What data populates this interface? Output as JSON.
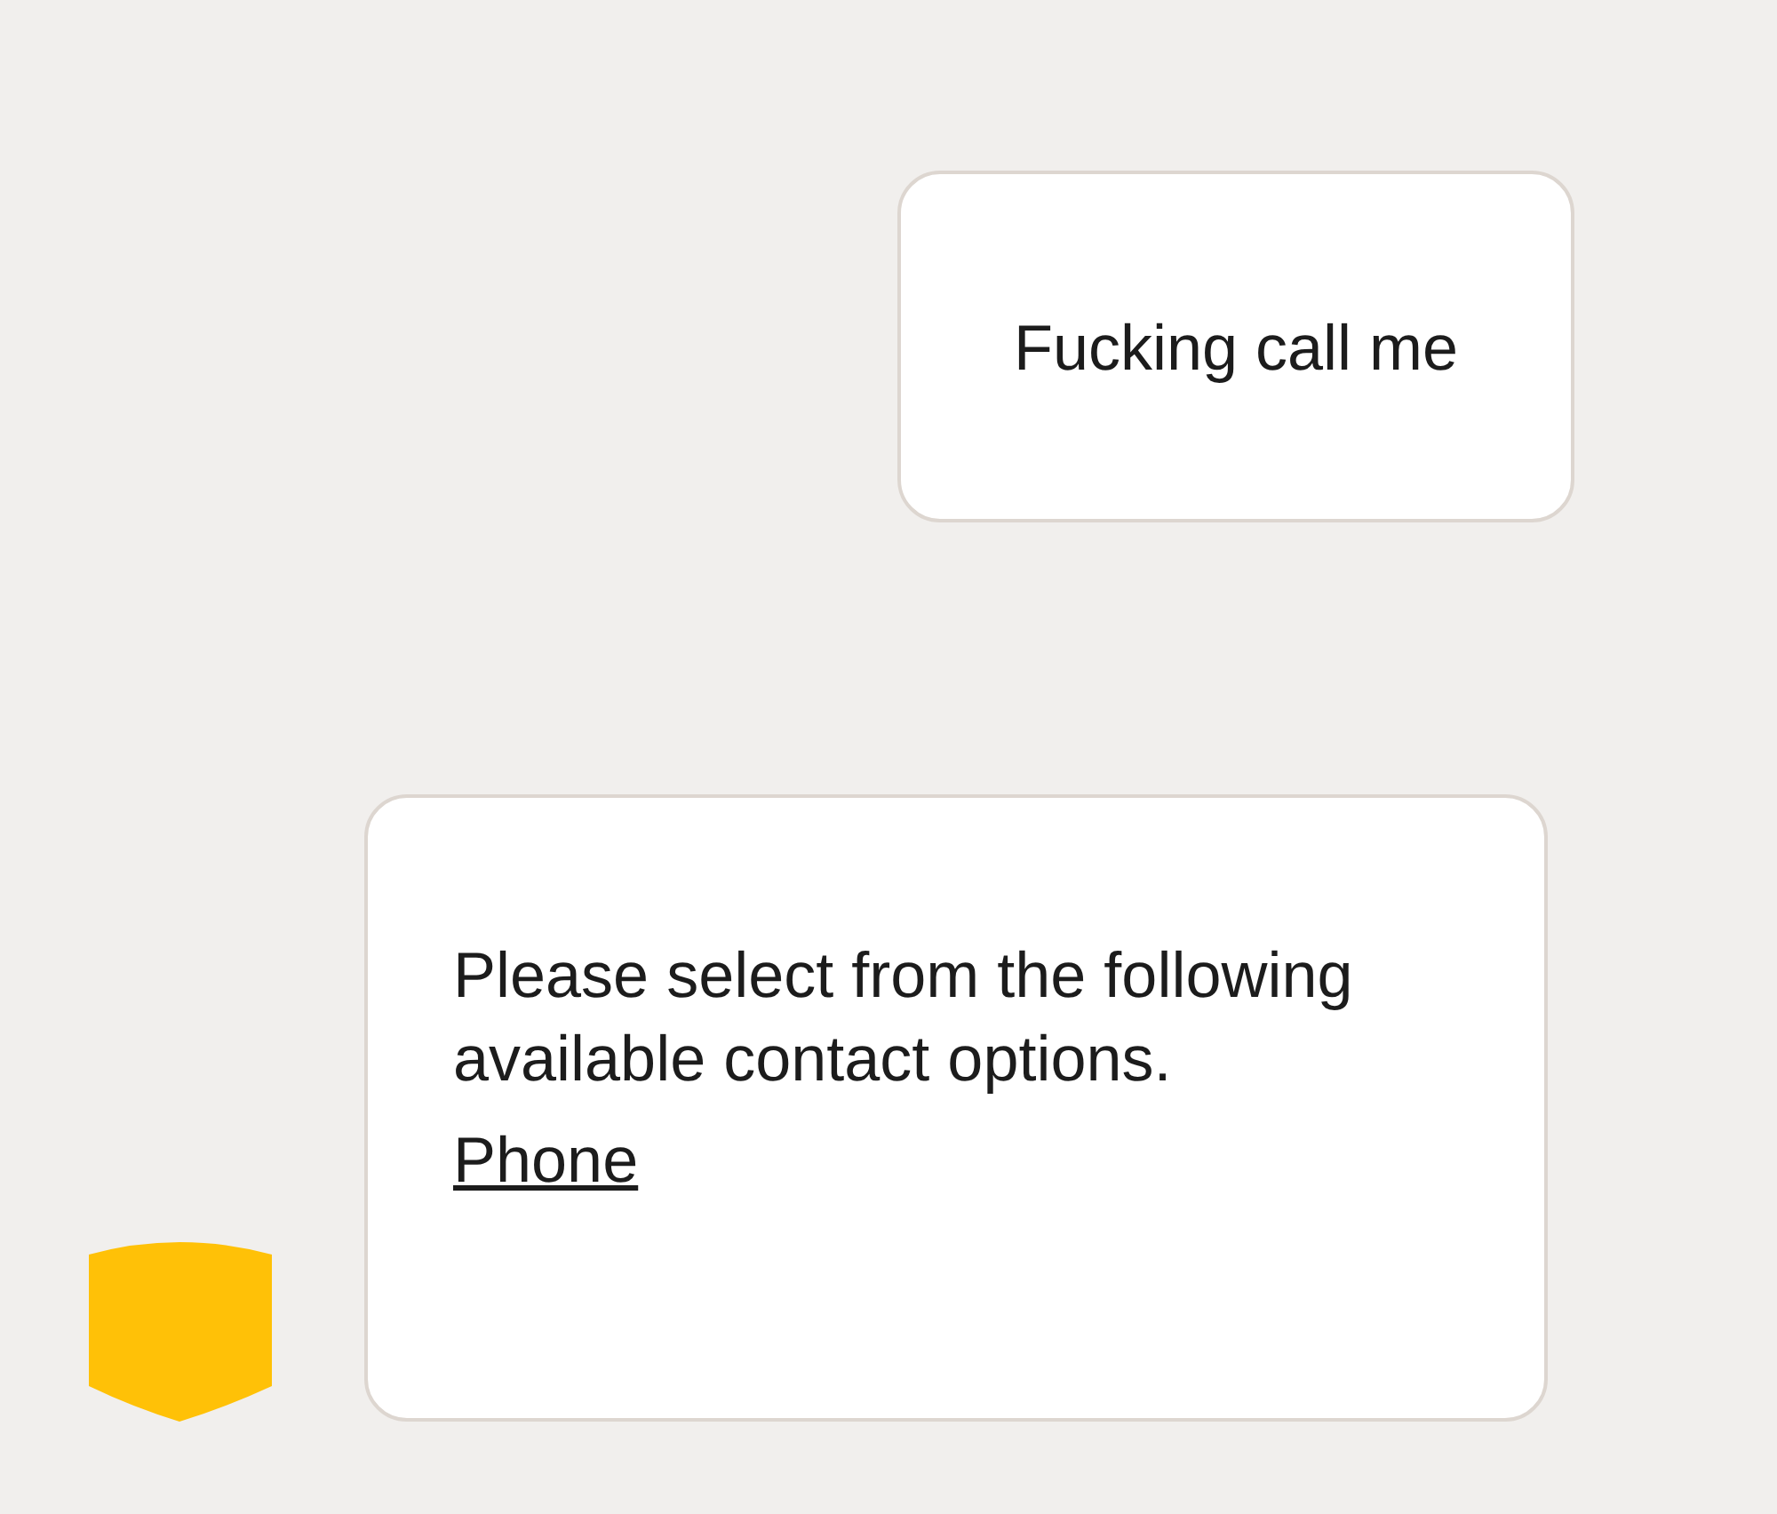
{
  "messages": [
    {
      "kind": "user",
      "text": "Fucking call me"
    },
    {
      "kind": "bot",
      "text": "Please select from the following available contact options.",
      "links": [
        "Phone"
      ]
    }
  ]
}
